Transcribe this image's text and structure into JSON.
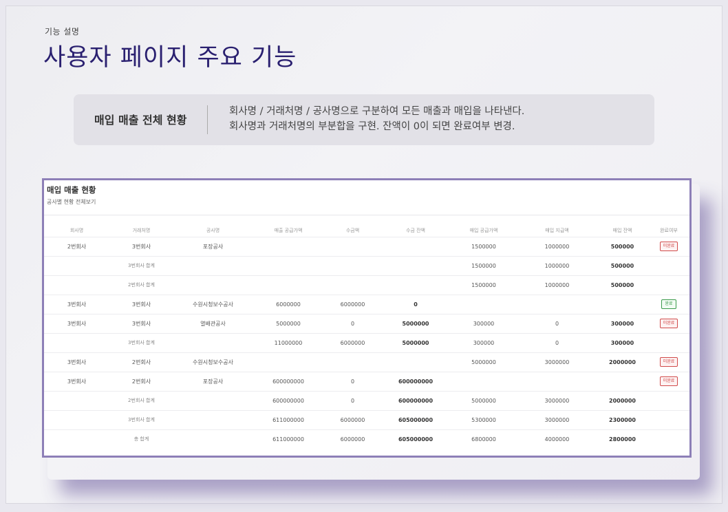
{
  "slide": {
    "eyebrow": "기능 설명",
    "title": "사용자 페이지 주요 기능"
  },
  "description": {
    "label": "매입 매출 전체 현황",
    "line1": "회사명 / 거래처명 / 공사명으로 구분하여 모든 매출과 매입을 나타낸다.",
    "line2": "회사명과 거래처명의 부분합을 구현.  잔액이 0이 되면 완료여부 변경."
  },
  "panel": {
    "title": "매입 매출 현황",
    "subtitle": "공사별 현황 전체보기"
  },
  "table": {
    "headers": [
      "회사명",
      "거래처명",
      "공사명",
      "매출 공급가액",
      "수금액",
      "수금 잔액",
      "매입 공급가액",
      "매입 지급액",
      "매입 잔액",
      "완료여부"
    ],
    "rows": [
      {
        "cells": [
          "2번회사",
          "3번회사",
          "포장공사",
          "",
          "",
          "",
          "1500000",
          "1000000",
          "500000",
          "미완료"
        ],
        "subtotal": false
      },
      {
        "cells": [
          "",
          "3번회사 합계",
          "",
          "",
          "",
          "",
          "1500000",
          "1000000",
          "500000",
          ""
        ],
        "subtotal": true
      },
      {
        "cells": [
          "",
          "2번회사 합계",
          "",
          "",
          "",
          "",
          "1500000",
          "1000000",
          "500000",
          ""
        ],
        "subtotal": true
      },
      {
        "cells": [
          "3번회사",
          "3번회사",
          "수원시청보수공사",
          "6000000",
          "6000000",
          "0",
          "",
          "",
          "",
          "완료"
        ],
        "subtotal": false
      },
      {
        "cells": [
          "3번회사",
          "3번회사",
          "열배관공사",
          "5000000",
          "0",
          "5000000",
          "300000",
          "0",
          "300000",
          "미완료"
        ],
        "subtotal": false
      },
      {
        "cells": [
          "",
          "3번회사 합계",
          "",
          "11000000",
          "6000000",
          "5000000",
          "300000",
          "0",
          "300000",
          ""
        ],
        "subtotal": true
      },
      {
        "cells": [
          "3번회사",
          "2번회사",
          "수원시청보수공사",
          "",
          "",
          "",
          "5000000",
          "3000000",
          "2000000",
          "미완료"
        ],
        "subtotal": false
      },
      {
        "cells": [
          "3번회사",
          "2번회사",
          "포장공사",
          "600000000",
          "0",
          "600000000",
          "",
          "",
          "",
          "미완료"
        ],
        "subtotal": false
      },
      {
        "cells": [
          "",
          "2번회사 합계",
          "",
          "600000000",
          "0",
          "600000000",
          "5000000",
          "3000000",
          "2000000",
          ""
        ],
        "subtotal": true
      },
      {
        "cells": [
          "",
          "3번회사 합계",
          "",
          "611000000",
          "6000000",
          "605000000",
          "5300000",
          "3000000",
          "2300000",
          ""
        ],
        "subtotal": true
      },
      {
        "cells": [
          "",
          "총 합계",
          "",
          "611000000",
          "6000000",
          "605000000",
          "6800000",
          "4000000",
          "2800000",
          ""
        ],
        "subtotal": true
      }
    ]
  },
  "colors": {
    "title": "#2a2070",
    "panel_border": "#8d7fb7",
    "status_incomplete": "#d14a4a",
    "status_complete": "#3a9a4a"
  }
}
